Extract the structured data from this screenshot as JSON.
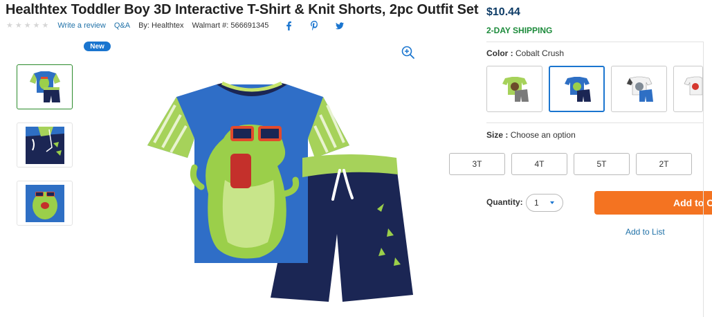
{
  "product": {
    "title": "Healthtex Toddler Boy 3D Interactive T-Shirt & Knit Shorts, 2pc Outfit Set",
    "rating_stars": 5,
    "write_review": "Write a review",
    "qa": "Q&A",
    "brand": "By: Healthtex",
    "walmart_number": "Walmart #: 566691345",
    "badge": "New"
  },
  "share": {
    "icons": [
      "facebook-icon",
      "pinterest-icon",
      "twitter-icon"
    ]
  },
  "purchase": {
    "price": "$10.44",
    "shipping": "2-DAY SHIPPING",
    "color_label": "Color :",
    "color_value": "Cobalt Crush",
    "size_label": "Size :",
    "size_value": "Choose an option",
    "sizes": [
      "3T",
      "4T",
      "5T",
      "2T"
    ],
    "quantity_label": "Quantity:",
    "quantity_value": "1",
    "add_to_cart": "Add to Cart",
    "add_to_list": "Add to List"
  },
  "colors": {
    "price_blue": "#0d3b66",
    "shipping_green": "#1c8b3b",
    "link_blue": "#2172a8",
    "accent_blue": "#1a75cf",
    "cart_orange": "#f47321"
  }
}
